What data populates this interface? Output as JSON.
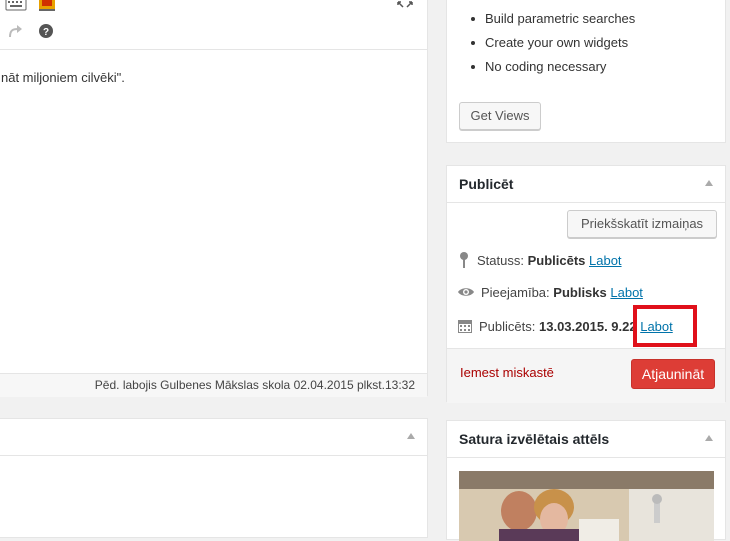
{
  "editor": {
    "content_text": "nāt miljoniem cilvēki\".",
    "last_edited": "Pēd. labojis Gulbenes Mākslas skola 02.04.2015 plkst.13:32",
    "icons": [
      "keyboard-icon",
      "color-icon",
      "fullscreen-icon",
      "redo-icon",
      "help-icon"
    ]
  },
  "views_box": {
    "features": [
      "Build parametric searches",
      "Create your own widgets",
      "No coding necessary"
    ],
    "button_label": "Get Views"
  },
  "publish": {
    "title": "Publicēt",
    "preview_button": "Priekšskatīt izmaiņas",
    "status_label": "Statuss:",
    "status_value": "Publicēts",
    "visibility_label": "Pieejamība:",
    "visibility_value": "Publisks",
    "published_label": "Publicēts:",
    "published_value": "13.03.2015. 9.22",
    "edit_link": "Labot",
    "trash_link": "Iemest miskastē",
    "update_button": "Atjaunināt"
  },
  "featured_image": {
    "title": "Satura izvēlētais attēls"
  },
  "colors": {
    "link": "#0073aa",
    "trash": "#a00000",
    "update_button": "#dd3d36",
    "highlight": "#e0101a"
  }
}
